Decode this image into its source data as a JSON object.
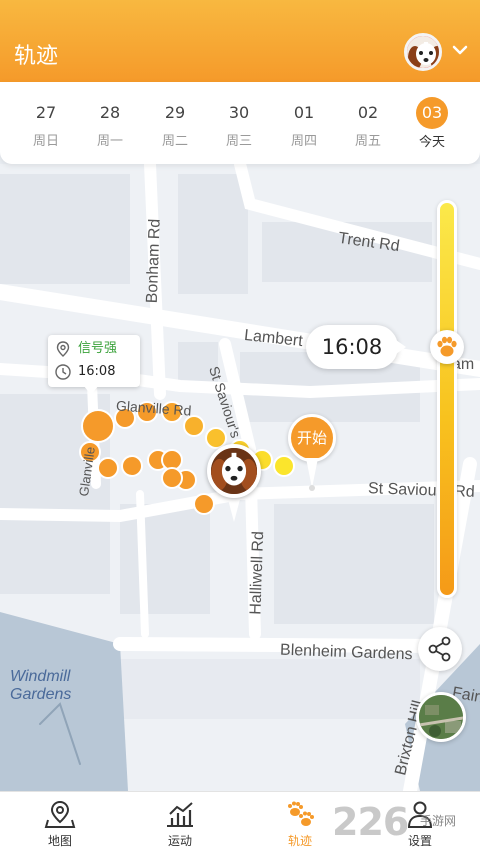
{
  "header": {
    "title": "轨迹"
  },
  "dates": [
    {
      "num": "27",
      "week": "周日"
    },
    {
      "num": "28",
      "week": "周一"
    },
    {
      "num": "29",
      "week": "周二"
    },
    {
      "num": "30",
      "week": "周三"
    },
    {
      "num": "01",
      "week": "周四"
    },
    {
      "num": "02",
      "week": "周五"
    },
    {
      "num": "03",
      "week": "今天",
      "active": true
    }
  ],
  "map": {
    "streets": [
      "Trent Rd",
      "Bonham Rd",
      "Lambert",
      "Glanville Rd",
      "St Saviour's",
      "Glanville",
      "Halliwell Rd",
      "St Saviours Rd",
      "Blenheim Gardens",
      "Brixton Hill",
      "Fairr"
    ],
    "park": [
      "Windmill",
      "Gardens"
    ],
    "slider_label_fragment": "am"
  },
  "info": {
    "signal": "信号强",
    "time": "16:08"
  },
  "slider": {
    "time": "16:08",
    "position": 0.37
  },
  "start_label": "开始",
  "colors": {
    "accent": "#f59a2a",
    "signal": "#3aa23a",
    "path_orange": "#f59a2a",
    "path_yellow": "#f8d52a"
  },
  "tabs": [
    {
      "label": "地图",
      "icon": "map-pin-icon"
    },
    {
      "label": "运动",
      "icon": "activity-chart-icon"
    },
    {
      "label": "轨迹",
      "icon": "paw-icon",
      "active": true
    },
    {
      "label": "设置",
      "icon": "user-settings-icon"
    }
  ],
  "watermark": {
    "big": "226",
    "small": "手游网"
  }
}
